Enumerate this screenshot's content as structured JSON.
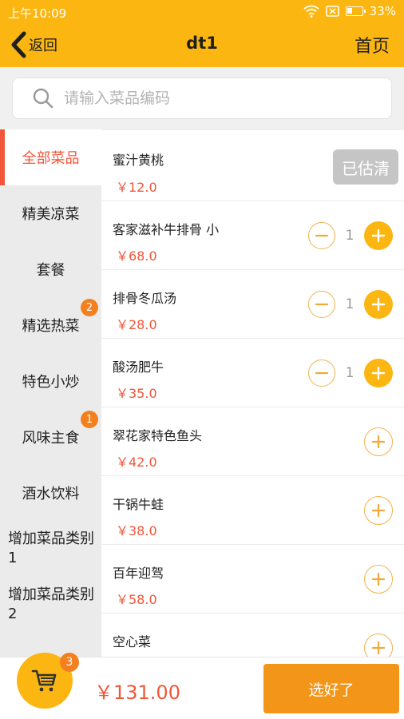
{
  "status_bar": {
    "time": "上午10:09",
    "battery": "33%",
    "battery_level": 0.33
  },
  "navbar": {
    "back_label": "返回",
    "title": "dt1",
    "home_label": "首页"
  },
  "search": {
    "placeholder": "请输入菜品编码",
    "value": ""
  },
  "categories": [
    {
      "label": "全部菜品",
      "active": true,
      "badge": ""
    },
    {
      "label": "精美凉菜",
      "active": false,
      "badge": ""
    },
    {
      "label": "套餐",
      "active": false,
      "badge": ""
    },
    {
      "label": "精选热菜",
      "active": false,
      "badge": "2"
    },
    {
      "label": "特色小炒",
      "active": false,
      "badge": ""
    },
    {
      "label": "风味主食",
      "active": false,
      "badge": "1"
    },
    {
      "label": "酒水饮料",
      "active": false,
      "badge": ""
    },
    {
      "label": "增加菜品类别1",
      "active": false,
      "badge": ""
    },
    {
      "label": "增加菜品类别2",
      "active": false,
      "badge": ""
    }
  ],
  "dishes": [
    {
      "name": "蜜汁黄桃",
      "price": "￥12.0",
      "sold_out_label": "已估清"
    },
    {
      "name": "客家滋补牛排骨 小",
      "price": "￥68.0",
      "qty": "1"
    },
    {
      "name": "排骨冬瓜汤",
      "price": "￥28.0",
      "qty": "1"
    },
    {
      "name": "酸汤肥牛",
      "price": "￥35.0",
      "qty": "1"
    },
    {
      "name": "翠花家特色鱼头",
      "price": "￥42.0"
    },
    {
      "name": "干锅牛蛙",
      "price": "￥38.0"
    },
    {
      "name": "百年迎驾",
      "price": "￥58.0"
    },
    {
      "name": "空心菜",
      "price": ""
    }
  ],
  "cart": {
    "count": "3",
    "total": "￥131.00",
    "done_label": "选好了"
  },
  "colors": {
    "brand": "#fbb611",
    "accent": "#f2563a",
    "done_button": "#f39518",
    "badge": "#f47f1f"
  }
}
